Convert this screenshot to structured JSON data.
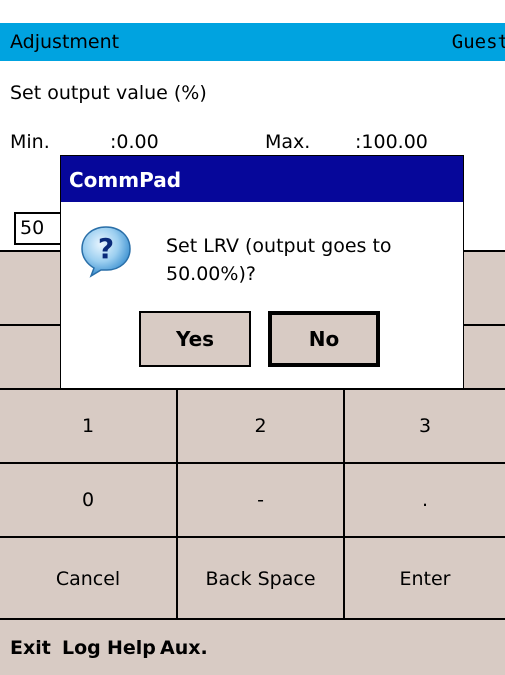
{
  "header": {
    "title": "Adjustment",
    "user": "Guest"
  },
  "form": {
    "prompt": "Set output value (%)",
    "min_label": "Min.",
    "min_value": ":0.00",
    "max_label": "Max.",
    "max_value": ":100.00",
    "input_value": "50"
  },
  "keypad": {
    "keys": [
      "1",
      "2",
      "3",
      "0",
      "-",
      ".",
      "Cancel",
      "Back Space",
      "Enter"
    ]
  },
  "menu": {
    "items": [
      "Exit",
      "Log",
      "Help",
      "Aux."
    ]
  },
  "dialog": {
    "title": "CommPad",
    "message": "Set LRV (output goes to 50.00%)?",
    "icon": "question-icon",
    "yes_label": "Yes",
    "no_label": "No"
  },
  "colors": {
    "title_bar": "#00a3e0",
    "dialog_title": "#06079a",
    "button_face": "#d8cbc4"
  }
}
